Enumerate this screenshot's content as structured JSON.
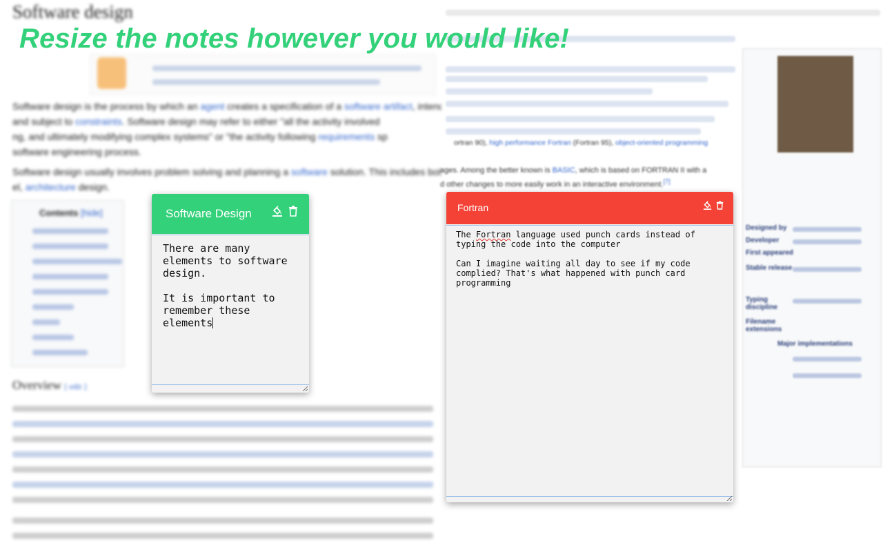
{
  "headline": "Resize the notes however you would like!",
  "background": {
    "title": "Software design",
    "para1_a": "Software design is the process by which an ",
    "para1_link1": "agent",
    "para1_b": " creates a specification of a ",
    "para1_link2": "software artifact",
    "para1_c": ", intended to accomplish goals, using a set of primitive components",
    "para2_a": "and subject to ",
    "para2_link": "constraints",
    "para2_b": ". Software design may refer to either \"all the activity involved",
    "para3": "ng, and ultimately modifying complex systems\" or \"the activity following ",
    "para3_link": "requirements",
    "para3_b": " sp",
    "para4": "software engineering process.",
    "para5_a": "Software design usually involves problem solving and planning a ",
    "para5_link": "software",
    "para5_b": " solution. This includes bot",
    "para6_a": "el, ",
    "para6_link": "architecture",
    "para6_b": " design.",
    "toc_title": "Contents",
    "toc_hide": "[hide]",
    "section": "Overview",
    "section_edit": "[ edit ]",
    "right_line1": "ages. Among the better known is ",
    "right_line1_link": "BASIC",
    "right_line1_b": ", which is based on FORTRAN II with a",
    "right_line2": "d other changes to more easily work in an interactive environment.",
    "right_line2_ref": "[7]",
    "right_small1": "ortran 90), ",
    "right_small1_link": "high performance Fortran",
    "right_small1_b": " (Fortran 95), ",
    "right_small1_link2": "object-oriented programming",
    "infobox_labels": [
      "Designed by",
      "Developer",
      "First appeared",
      "Stable release",
      "Typing discipline",
      "Filename extensions",
      "Major implementations"
    ]
  },
  "notes": [
    {
      "title": "Software Design",
      "color": "#33d17a",
      "body_line1": "There are many",
      "body_line2": "elements to software",
      "body_line3": "design.",
      "body_line4": "It is important to",
      "body_line5": "remember these",
      "body_line6": "elements"
    },
    {
      "title": "Fortran",
      "color": "#f44336",
      "body_line1_a": "The ",
      "body_line1_word": "Fortran",
      "body_line1_b": " language used punch cards instead of",
      "body_line2": "typing the code into the computer",
      "body_line3": "Can I imagine waiting all day to see if my code",
      "body_line4": "complied? That's what happened with punch card",
      "body_line5": "programming"
    }
  ],
  "icons": {
    "color_fill": "paint-bucket-icon",
    "delete": "trash-icon",
    "resize": "resize-grip-icon"
  }
}
